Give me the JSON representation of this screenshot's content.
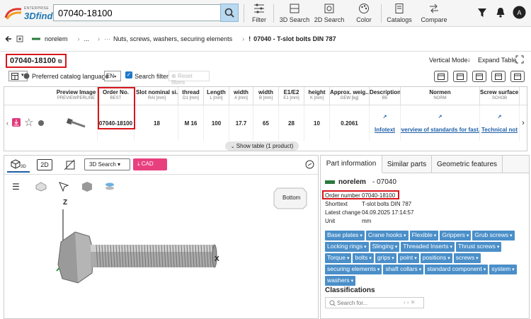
{
  "logo": {
    "line1": "ENTERPRISE",
    "line2": "3Dfindit"
  },
  "search": {
    "value": "07040-18100"
  },
  "toolbar": {
    "filter": "Filter",
    "search3d": "3D Search",
    "search2d": "2D Search",
    "color": "Color",
    "catalogs": "Catalogs",
    "compare": "Compare"
  },
  "breadcrumb": {
    "supplier": "norelem",
    "ellipsis": "...",
    "category": "Nuts, screws, washers, securing elements",
    "part": "07040 - T-slot bolts DIN 787"
  },
  "title": {
    "text": "07040-18100",
    "vertical": "Vertical Mode",
    "expand": "Expand Table"
  },
  "filters": {
    "lang_label": "Preferred catalog language",
    "lang": "EN",
    "search_filter": "Search filter",
    "reset": "Reset filters"
  },
  "table": {
    "headers": [
      {
        "t": "Preview Image",
        "s": "PREVIEWPERLINE"
      },
      {
        "t": "Order No.",
        "s": "BEST"
      },
      {
        "t": "Slot nominal si...",
        "s": "RAI [mm]"
      },
      {
        "t": "thread",
        "s": "D1 [mm]"
      },
      {
        "t": "Length",
        "s": "L [mm]"
      },
      {
        "t": "width",
        "s": "A [mm]"
      },
      {
        "t": "width",
        "s": "B [mm]"
      },
      {
        "t": "E1/E2",
        "s": "E1 [mm]"
      },
      {
        "t": "height",
        "s": "K [mm]"
      },
      {
        "t": "Approx. weig...",
        "s": "GEW [kg]"
      },
      {
        "t": "Description",
        "s": "B5"
      },
      {
        "t": "Normen",
        "s": "NORM"
      },
      {
        "t": "Screw surface fi...",
        "s": "SCHOB"
      }
    ],
    "row": [
      "",
      "07040-18100",
      "18",
      "M 16",
      "100",
      "17.7",
      "65",
      "28",
      "10",
      "0.2061",
      "Infotext",
      "Overview of standards for fast...",
      "Technical not"
    ],
    "show": "Show table (1 product)"
  },
  "viewer": {
    "tab3d": "3D",
    "tab2d": "2D",
    "search3d": "3D Search",
    "cad": "CAD",
    "view": "Bottom",
    "axis_x": "X",
    "axis_z": "Z"
  },
  "panel": {
    "tabs": [
      "Part information",
      "Similar parts",
      "Geometric features"
    ],
    "supplier": "norelem",
    "part": "- 07040",
    "fields": [
      {
        "k": "Order number",
        "v": "07040-18100"
      },
      {
        "k": "Shorttext",
        "v": "T-slot bolts DIN 787"
      },
      {
        "k": "Latest change",
        "v": "04.09.2025 17:14:57"
      },
      {
        "k": "Unit",
        "v": "mm"
      }
    ],
    "tags": [
      "Base plates",
      "Crane hooks",
      "Flexible",
      "Grippers",
      "Grub screws",
      "Locking rings",
      "Slinging",
      "Threaded Inserts",
      "Thrust screws",
      "Torque",
      "bolts",
      "grips",
      "point",
      "positions",
      "screws",
      "securing elements",
      "shaft collars",
      "standard component",
      "system",
      "washers"
    ],
    "classifications": "Classifications",
    "search_placeholder": "Search for..."
  }
}
